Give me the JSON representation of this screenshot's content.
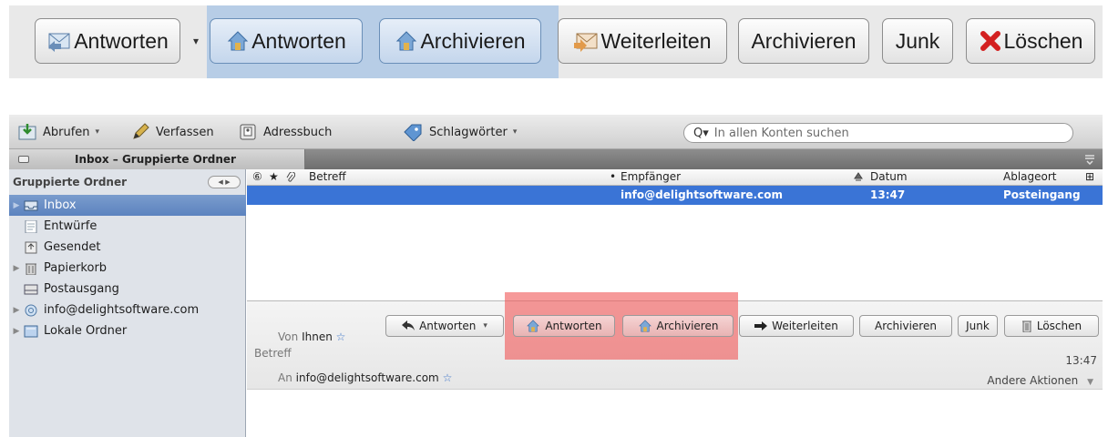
{
  "zoom_toolbar": {
    "buttons": [
      {
        "label": "Antworten"
      },
      {
        "label": "Antworten"
      },
      {
        "label": "Archivieren"
      },
      {
        "label": "Weiterleiten"
      },
      {
        "label": "Archivieren"
      },
      {
        "label": "Junk"
      },
      {
        "label": "Löschen"
      }
    ],
    "dropdown_caret": "▾"
  },
  "toolbar": {
    "get_mail": "Abrufen",
    "compose": "Verfassen",
    "address_book": "Adressbuch",
    "tags": "Schlagwörter",
    "caret": "▾",
    "search_placeholder": "In allen Konten suchen"
  },
  "tab": {
    "title": "Inbox – Gruppierte Ordner"
  },
  "sidebar": {
    "header": "Gruppierte Ordner",
    "folders": [
      {
        "label": "Inbox",
        "selected": true,
        "icon": "inbox-icon"
      },
      {
        "label": "Entwürfe",
        "icon": "drafts-icon"
      },
      {
        "label": "Gesendet",
        "icon": "sent-icon"
      },
      {
        "label": "Papierkorb",
        "icon": "trash-icon"
      },
      {
        "label": "Postausgang",
        "icon": "outbox-icon"
      },
      {
        "label": "info@delightsoftware.com",
        "icon": "account-icon"
      },
      {
        "label": "Lokale Ordner",
        "icon": "local-folders-icon"
      }
    ]
  },
  "message_list": {
    "columns": {
      "subject": "Betreff",
      "recipient": "Empfänger",
      "date": "Datum",
      "location": "Ablageort"
    },
    "rows": [
      {
        "recipient": "info@delightsoftware.com",
        "date": "13:47",
        "location": "Posteingang"
      }
    ]
  },
  "preview": {
    "buttons": {
      "reply": "Antworten",
      "reply_label": "Antworten",
      "archive_label": "Archivieren",
      "forward": "Weiterleiten",
      "archive": "Archivieren",
      "junk": "Junk",
      "delete": "Löschen"
    },
    "from_label": "Von",
    "from_value": "Ihnen",
    "subject_label": "Betreff",
    "time": "13:47",
    "to_label": "An",
    "to_value": "info@delightsoftware.com",
    "other_actions": "Andere Aktionen",
    "other_caret": "▼"
  },
  "colors": {
    "selection": "#3a74d6",
    "highlight_blue": "#b7cde6",
    "highlight_red": "#f05a5a",
    "delete_red": "#d32020"
  }
}
